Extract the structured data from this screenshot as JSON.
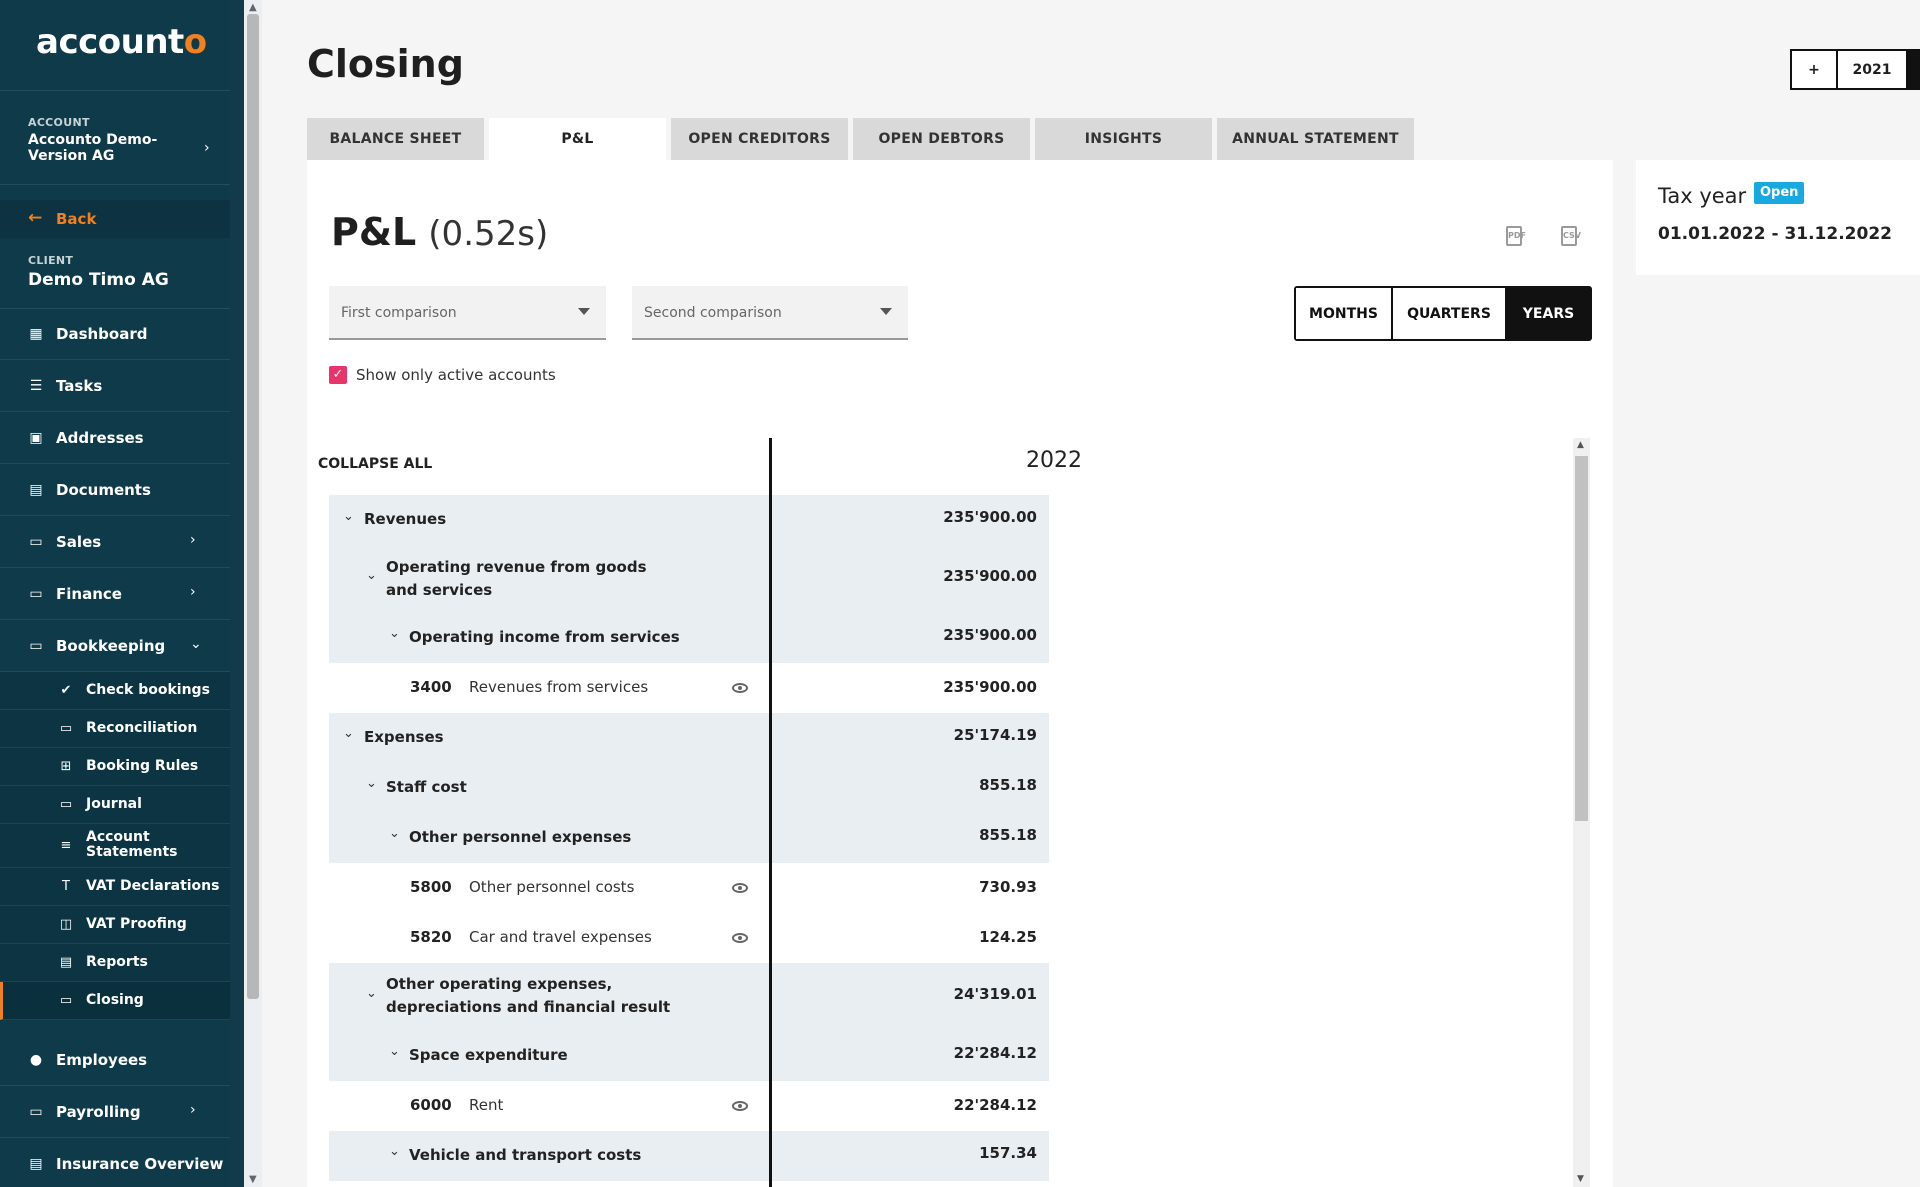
{
  "app": {
    "logo_text": "account",
    "logo_accent": "o"
  },
  "sidebar": {
    "account_caption": "ACCOUNT",
    "account_name": "Accounto Demo-Version AG",
    "back_label": "Back",
    "client_caption": "CLIENT",
    "client_name": "Demo Timo AG",
    "items": [
      {
        "label": "Dashboard",
        "icon": "dashboard-icon"
      },
      {
        "label": "Tasks",
        "icon": "tasks-icon"
      },
      {
        "label": "Addresses",
        "icon": "addresses-icon"
      },
      {
        "label": "Documents",
        "icon": "documents-icon"
      },
      {
        "label": "Sales",
        "icon": "sales-icon",
        "has_children": true
      },
      {
        "label": "Finance",
        "icon": "finance-icon",
        "has_children": true
      },
      {
        "label": "Bookkeeping",
        "icon": "bookkeeping-icon",
        "expanded": true
      }
    ],
    "bookkeeping_sub": [
      {
        "label": "Check bookings",
        "icon": "check-icon"
      },
      {
        "label": "Reconciliation",
        "icon": "reconciliation-icon"
      },
      {
        "label": "Booking Rules",
        "icon": "table-icon"
      },
      {
        "label": "Journal",
        "icon": "journal-icon"
      },
      {
        "label": "Account Statements",
        "icon": "list-icon"
      },
      {
        "label": "VAT Declarations",
        "icon": "text-icon"
      },
      {
        "label": "VAT Proofing",
        "icon": "proofing-icon"
      },
      {
        "label": "Reports",
        "icon": "report-icon"
      },
      {
        "label": "Closing",
        "icon": "closing-icon",
        "active": true
      }
    ],
    "items_after": [
      {
        "label": "Employees",
        "icon": "person-icon"
      },
      {
        "label": "Payrolling",
        "icon": "payroll-icon",
        "has_children": true
      },
      {
        "label": "Insurance Overview",
        "icon": "insurance-icon"
      }
    ]
  },
  "header": {
    "title": "Closing",
    "year_add": "+",
    "year": "2021"
  },
  "tabs": [
    {
      "label": "BALANCE SHEET"
    },
    {
      "label": "P&L",
      "active": true
    },
    {
      "label": "OPEN CREDITORS"
    },
    {
      "label": "OPEN DEBTORS"
    },
    {
      "label": "INSIGHTS"
    },
    {
      "label": "ANNUAL STATEMENT"
    }
  ],
  "report": {
    "title": "P&L",
    "timing": "(0.52s)",
    "export_pdf_icon": "pdf-icon",
    "export_csv_icon": "csv-icon",
    "first_comparison_placeholder": "First comparison",
    "second_comparison_placeholder": "Second comparison",
    "period_options": [
      "MONTHS",
      "QUARTERS",
      "YEARS"
    ],
    "period_selected": "YEARS",
    "active_only_label": "Show only active accounts",
    "active_only_checked": true,
    "collapse_all_label": "COLLAPSE ALL",
    "column_year": "2022"
  },
  "rows": [
    {
      "kind": "group",
      "level": 0,
      "name": "Revenues",
      "value": "235'900.00"
    },
    {
      "kind": "group",
      "level": 1,
      "name": "Operating revenue from goods and services",
      "value": "235'900.00"
    },
    {
      "kind": "group",
      "level": 2,
      "name": "Operating income from services",
      "value": "235'900.00"
    },
    {
      "kind": "leaf",
      "account": "3400",
      "name": "Revenues from services",
      "value": "235'900.00"
    },
    {
      "kind": "group",
      "level": 0,
      "name": "Expenses",
      "value": "25'174.19"
    },
    {
      "kind": "group",
      "level": 1,
      "name": "Staff cost",
      "value": "855.18"
    },
    {
      "kind": "group",
      "level": 2,
      "name": "Other personnel expenses",
      "value": "855.18"
    },
    {
      "kind": "leaf",
      "account": "5800",
      "name": "Other personnel costs",
      "value": "730.93"
    },
    {
      "kind": "leaf",
      "account": "5820",
      "name": "Car and travel expenses",
      "value": "124.25"
    },
    {
      "kind": "group",
      "level": 1,
      "name": "Other operating expenses, depreciations and financial result",
      "value": "24'319.01"
    },
    {
      "kind": "group",
      "level": 2,
      "name": "Space expenditure",
      "value": "22'284.12"
    },
    {
      "kind": "leaf",
      "account": "6000",
      "name": "Rent",
      "value": "22'284.12"
    },
    {
      "kind": "group",
      "level": 2,
      "name": "Vehicle and transport costs",
      "value": "157.34"
    }
  ],
  "tax_year": {
    "title": "Tax year",
    "status": "Open",
    "dates": "01.01.2022 - 31.12.2022",
    "status_color": "#19a9e1"
  },
  "colors": {
    "accent": "#f08020",
    "sidebar_bg": "#123a4b",
    "checkbox": "#e8336b"
  }
}
